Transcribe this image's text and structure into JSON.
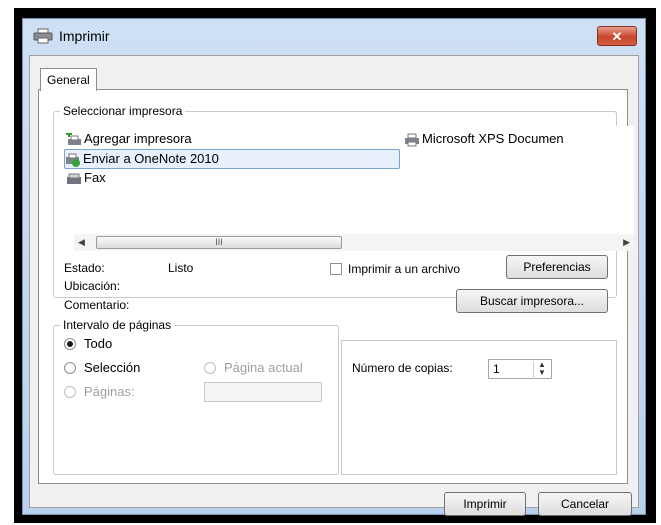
{
  "window": {
    "title": "Imprimir",
    "close_glyph": "✕",
    "accent": "#c9452c"
  },
  "tabs": [
    {
      "label": "General"
    }
  ],
  "select_printer": {
    "legend": "Seleccionar impresora",
    "printers": [
      {
        "name": "Agregar impresora",
        "icon": "add-printer-icon",
        "selected": false
      },
      {
        "name": "Microsoft XPS Documen",
        "icon": "printer-icon",
        "selected": false
      },
      {
        "name": "Enviar a OneNote 2010",
        "icon": "onenote-printer-icon",
        "selected": true
      },
      {
        "name": "Fax",
        "icon": "fax-icon",
        "selected": false
      }
    ],
    "scroll_thumb_glyph": "III",
    "status_label": "Estado:",
    "status_value": "Listo",
    "location_label": "Ubicación:",
    "comment_label": "Comentario:",
    "print_to_file_label": "Imprimir a un archivo",
    "print_to_file_checked": false,
    "preferences_button": "Preferencias",
    "find_printer_button": "Buscar impresora..."
  },
  "page_range": {
    "legend": "Intervalo de páginas",
    "all_label": "Todo",
    "all_selected": true,
    "selection_label": "Selección",
    "current_page_label": "Página actual",
    "pages_label": "Páginas:",
    "pages_value": ""
  },
  "copies": {
    "label": "Número de copias:",
    "value": "1"
  },
  "footer": {
    "print_button": "Imprimir",
    "cancel_button": "Cancelar"
  }
}
